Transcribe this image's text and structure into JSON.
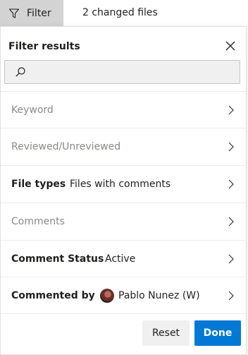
{
  "toolbar": {
    "filter_label": "Filter",
    "changed_files": "2 changed files"
  },
  "panel": {
    "title": "Filter results",
    "search": {
      "value": "",
      "placeholder": ""
    },
    "rows": [
      {
        "label": "Keyword",
        "value": ""
      },
      {
        "label": "Reviewed/Unreviewed",
        "value": ""
      },
      {
        "label": "File types",
        "value": "Files with comments"
      },
      {
        "label": "Comments",
        "value": ""
      },
      {
        "label": "Comment Status",
        "value": "Active"
      },
      {
        "label": "Commented by",
        "value": "Pablo Nunez (W)"
      }
    ],
    "reset_label": "Reset",
    "done_label": "Done"
  },
  "colors": {
    "accent": "#0078d4",
    "filter_button_bg": "#d3d3d3",
    "inactive_text": "#8a8886"
  },
  "icons": [
    "filter-icon",
    "close-icon",
    "search-icon",
    "chevron-right-icon",
    "avatar"
  ]
}
